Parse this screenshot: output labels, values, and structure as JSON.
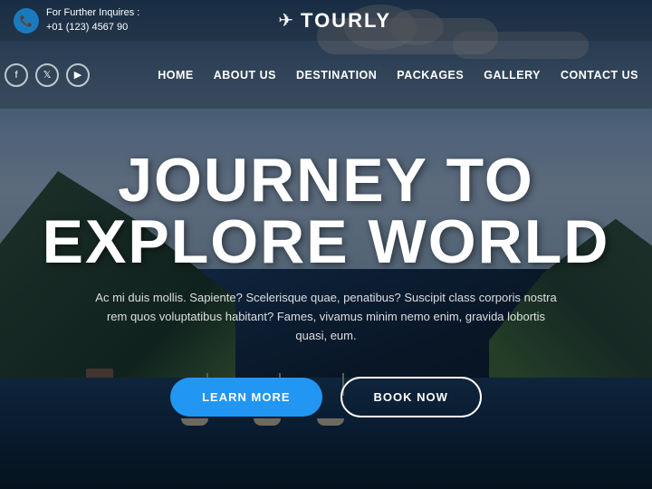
{
  "brand": {
    "logo_icon": "✈",
    "logo_text": "TOURLY"
  },
  "top_bar": {
    "inquiry_label": "For Further Inquires :",
    "phone": "+01 (123) 4567 90"
  },
  "social": {
    "icons": [
      {
        "name": "facebook",
        "symbol": "f"
      },
      {
        "name": "twitter",
        "symbol": "t"
      },
      {
        "name": "youtube",
        "symbol": "▶"
      }
    ]
  },
  "nav": {
    "links": [
      {
        "id": "home",
        "label": "HOME"
      },
      {
        "id": "about",
        "label": "ABOUT US"
      },
      {
        "id": "destination",
        "label": "DESTINATION"
      },
      {
        "id": "packages",
        "label": "PACKAGES"
      },
      {
        "id": "gallery",
        "label": "GALLERY"
      },
      {
        "id": "contact",
        "label": "CONTACT US"
      }
    ]
  },
  "hero": {
    "title_line1": "JOURNEY TO",
    "title_line2": "EXPLORE WORLD",
    "subtitle": "Ac mi duis mollis. Sapiente? Scelerisque quae, penatibus? Suscipit class corporis nostra rem quos voluptatibus habitant? Fames, vivamus minim nemo enim, gravida lobortis quasi, eum.",
    "btn_learn": "LEARN MORE",
    "btn_book": "BOOK NOW"
  }
}
